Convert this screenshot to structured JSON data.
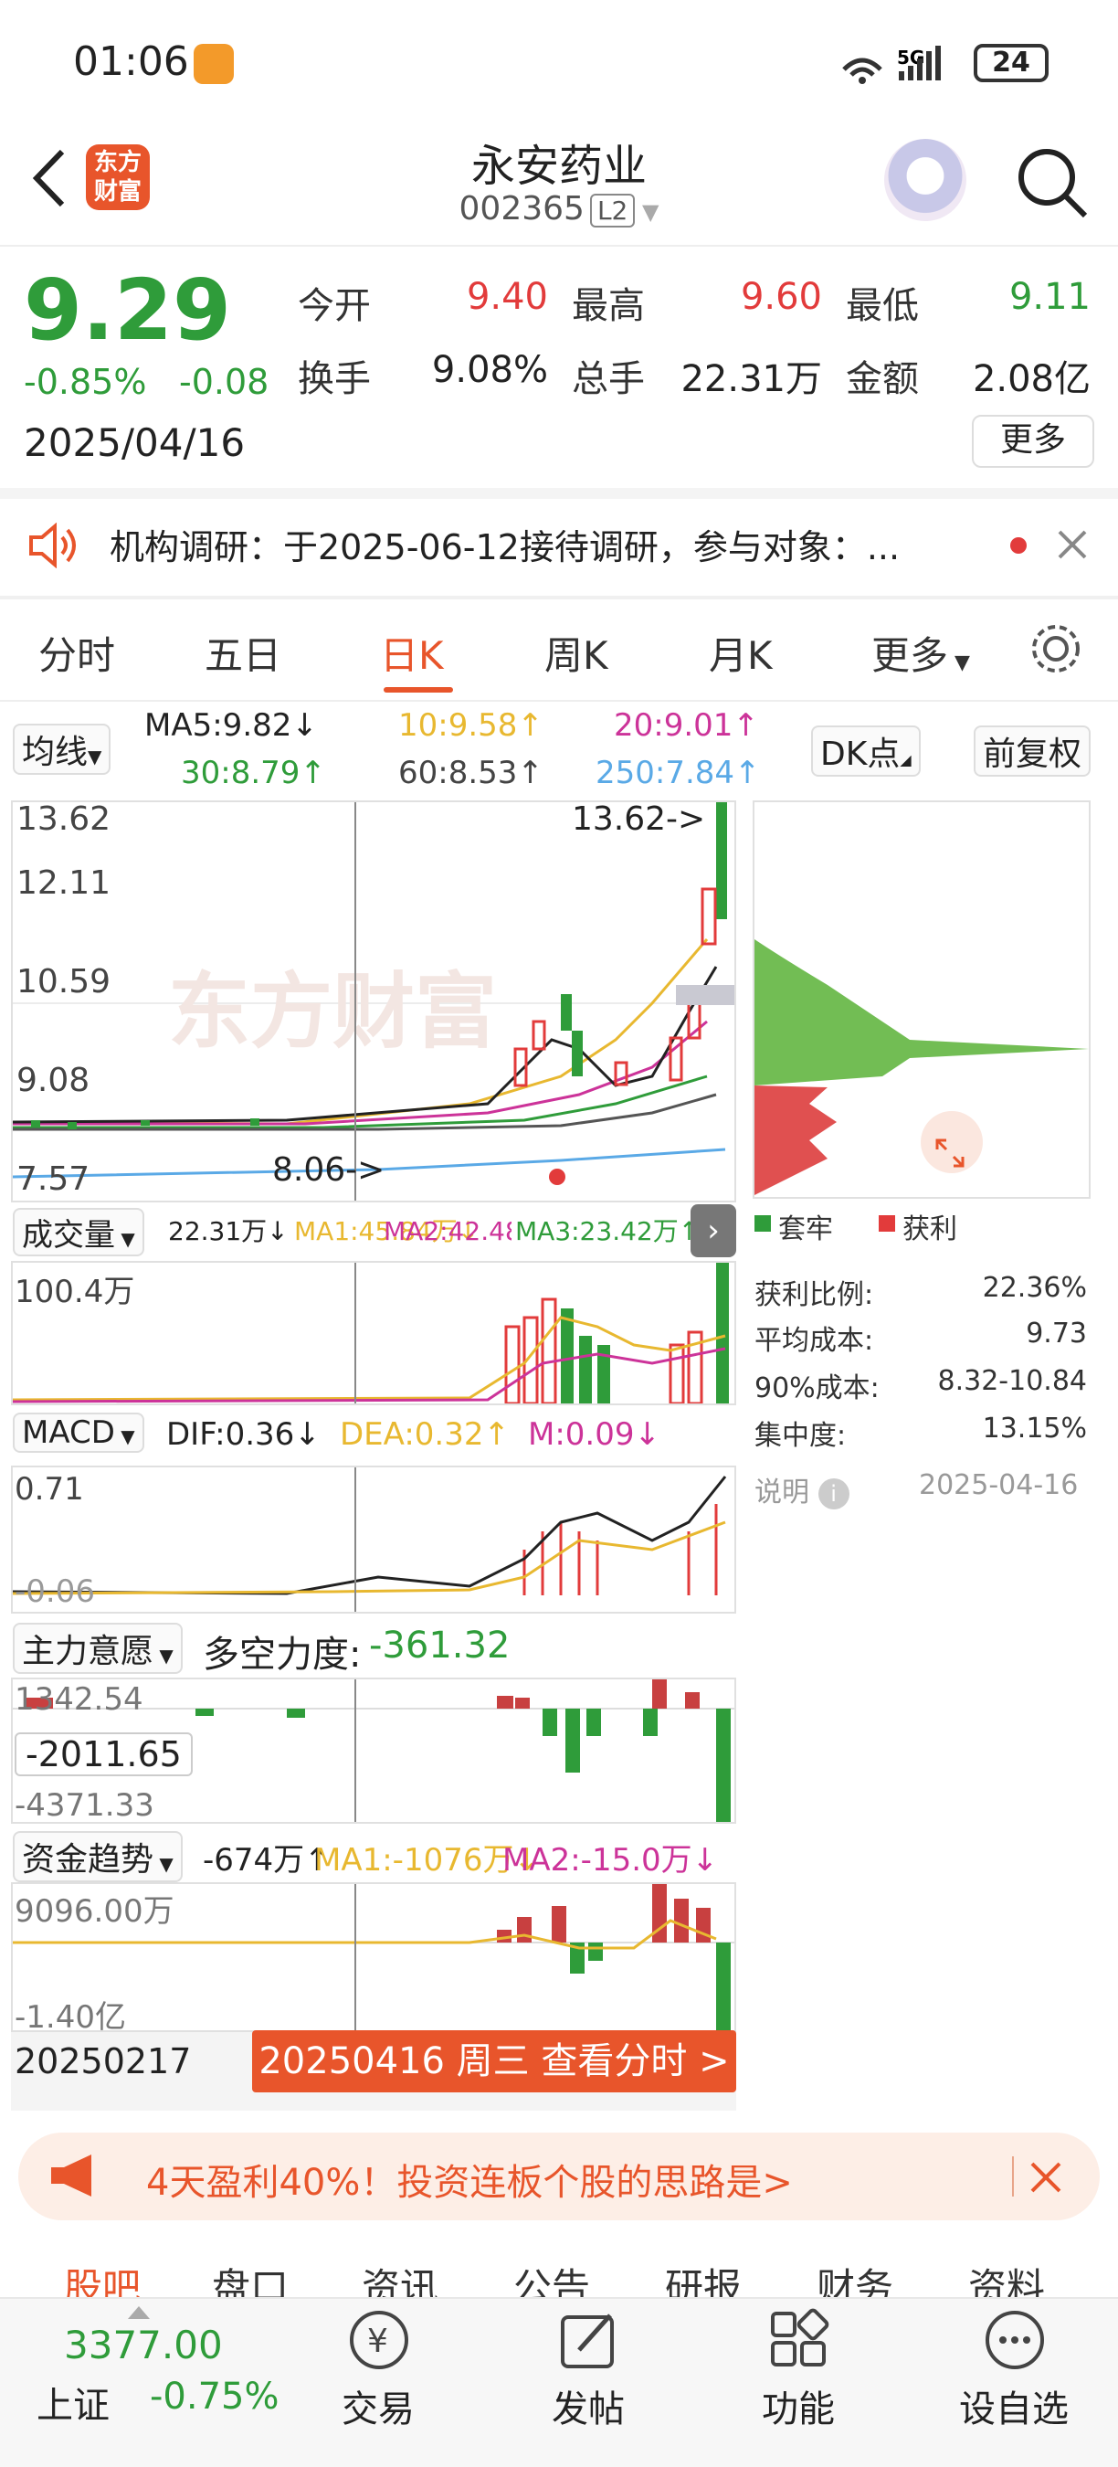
{
  "status_bar": {
    "time": "01:06",
    "network": "5G",
    "battery": "24"
  },
  "header": {
    "logo_text_1": "东方",
    "logo_text_2": "财富",
    "title": "永安药业",
    "code": "002365",
    "level": "L2"
  },
  "quote": {
    "price": "9.29",
    "change_pct": "-0.85%",
    "change_abs": "-0.08",
    "date": "2025/04/16",
    "open_label": "今开",
    "open": "9.40",
    "high_label": "最高",
    "high": "9.60",
    "low_label": "最低",
    "low": "9.11",
    "turnover_label": "换手",
    "turnover": "9.08%",
    "volume_label": "总手",
    "volume": "22.31万",
    "amount_label": "金额",
    "amount": "2.08亿",
    "more": "更多"
  },
  "notice": {
    "text": "机构调研：于2025-06-12接待调研，参与对象：..."
  },
  "k_tabs": [
    "分时",
    "五日",
    "日K",
    "周K",
    "月K",
    "更多"
  ],
  "ma": {
    "selector": "均线",
    "ma5": "MA5:9.82↓",
    "ma10": "10:9.58↑",
    "ma20": "20:9.01↑",
    "ma30": "30:8.79↑",
    "ma60": "60:8.53↑",
    "ma250": "250:7.84↑",
    "dk_button": "DK点",
    "adjust_button": "前复权"
  },
  "main_chart": {
    "y_labels": [
      "13.62",
      "12.11",
      "10.59",
      "9.08",
      "7.57"
    ],
    "high_marker": "13.62->",
    "low_marker": "8.06->",
    "watermark": "东方财富"
  },
  "volume": {
    "selector": "成交量",
    "value": "22.31万↓",
    "ma1": "MA1:45.84万↓",
    "ma2": "MA2:42.48万↑",
    "ma3": "MA3:23.42万↑",
    "y_label": "100.4万"
  },
  "macd": {
    "selector": "MACD",
    "dif": "DIF:0.36↓",
    "dea": "DEA:0.32↑",
    "m": "M:0.09↓",
    "y_top": "0.71",
    "y_bottom": "-0.06"
  },
  "force": {
    "selector": "主力意愿",
    "label": "多空力度:",
    "value": "-361.32",
    "y_top": "1342.54",
    "cursor_value": "-2011.65",
    "y_bottom": "-4371.33"
  },
  "fund": {
    "selector": "资金趋势",
    "value": "-674万↑",
    "ma1": "MA1:-1076万↓",
    "ma2": "MA2:-15.0万↓",
    "y_top": "9096.00万",
    "y_bottom": "-1.40亿"
  },
  "chips": {
    "legend_trapped": "套牢",
    "legend_profit": "获利",
    "rows": [
      {
        "label": "获利比例:",
        "value": "22.36%"
      },
      {
        "label": "平均成本:",
        "value": "9.73"
      },
      {
        "label": "90%成本:",
        "value": "8.32-10.84"
      },
      {
        "label": "集中度:",
        "value": "13.15%"
      }
    ],
    "note": "说明",
    "date": "2025-04-16"
  },
  "date_bar": {
    "start": "20250217",
    "selected": "20250416 周三 查看分时 >"
  },
  "ad": {
    "text": "4天盈利40%！投资连板个股的思路是>"
  },
  "bottom_tabs": [
    "股吧",
    "盘口",
    "资讯",
    "公告",
    "研报",
    "财务",
    "资料"
  ],
  "index": {
    "value": "3377.00",
    "name": "上证",
    "change": "-0.75%"
  },
  "nav": [
    {
      "label": "交易",
      "icon": "yen-icon"
    },
    {
      "label": "发帖",
      "icon": "edit-icon"
    },
    {
      "label": "功能",
      "icon": "grid-icon"
    },
    {
      "label": "设自选",
      "icon": "more-dots-icon"
    }
  ],
  "colors": {
    "up": "#e23b3b",
    "down": "#2f9c3a",
    "accent": "#e8552b",
    "ma10": "#e8b830",
    "ma20": "#cc3399",
    "ma250": "#5aa9e6"
  }
}
